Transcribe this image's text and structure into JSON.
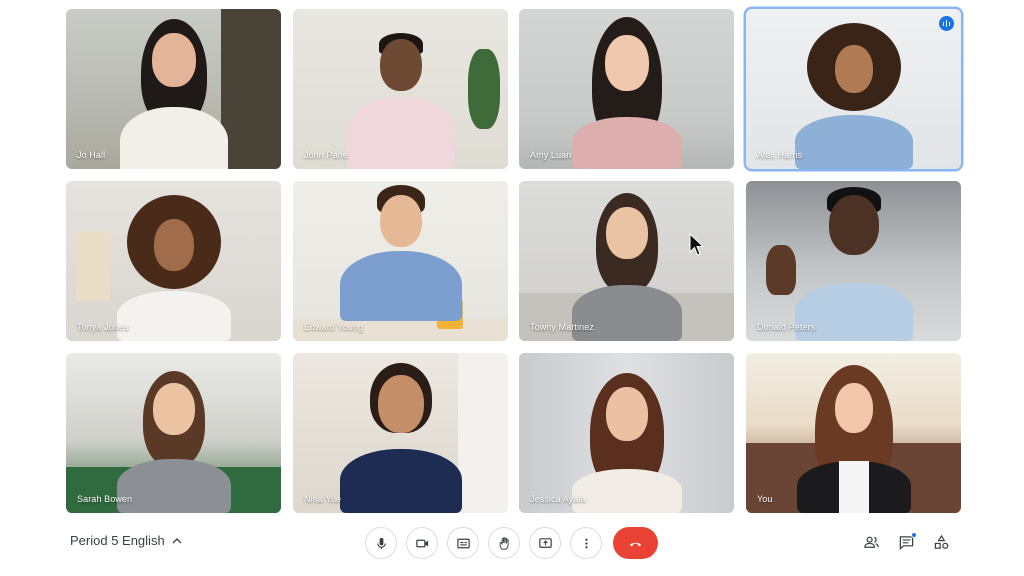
{
  "meeting": {
    "title": "Period 5 English"
  },
  "participants": [
    {
      "name": "Jo Hall"
    },
    {
      "name": "John Pane"
    },
    {
      "name": "Amy Luan"
    },
    {
      "name": "Alex Harris"
    },
    {
      "name": "Tonya Jones"
    },
    {
      "name": "Edward Young"
    },
    {
      "name": "Towny Martinez"
    },
    {
      "name": "Donald Peters"
    },
    {
      "name": "Sarah Bowen"
    },
    {
      "name": "Nina Yue"
    },
    {
      "name": "Jessica Ayala"
    },
    {
      "name": "You"
    }
  ],
  "active_speaker": "Alex Harris",
  "controls": [
    {
      "icon": "microphone-icon"
    },
    {
      "icon": "camera-icon"
    },
    {
      "icon": "captions-icon"
    },
    {
      "icon": "raise-hand-icon"
    },
    {
      "icon": "present-screen-icon"
    },
    {
      "icon": "more-options-icon"
    },
    {
      "icon": "end-call-icon"
    }
  ],
  "side_controls": [
    {
      "icon": "people-icon"
    },
    {
      "icon": "chat-icon"
    },
    {
      "icon": "activities-icon"
    }
  ],
  "colors": {
    "accent": "#1a73e8",
    "end_call": "#ea4335",
    "active_border": "#8ab4f8"
  }
}
